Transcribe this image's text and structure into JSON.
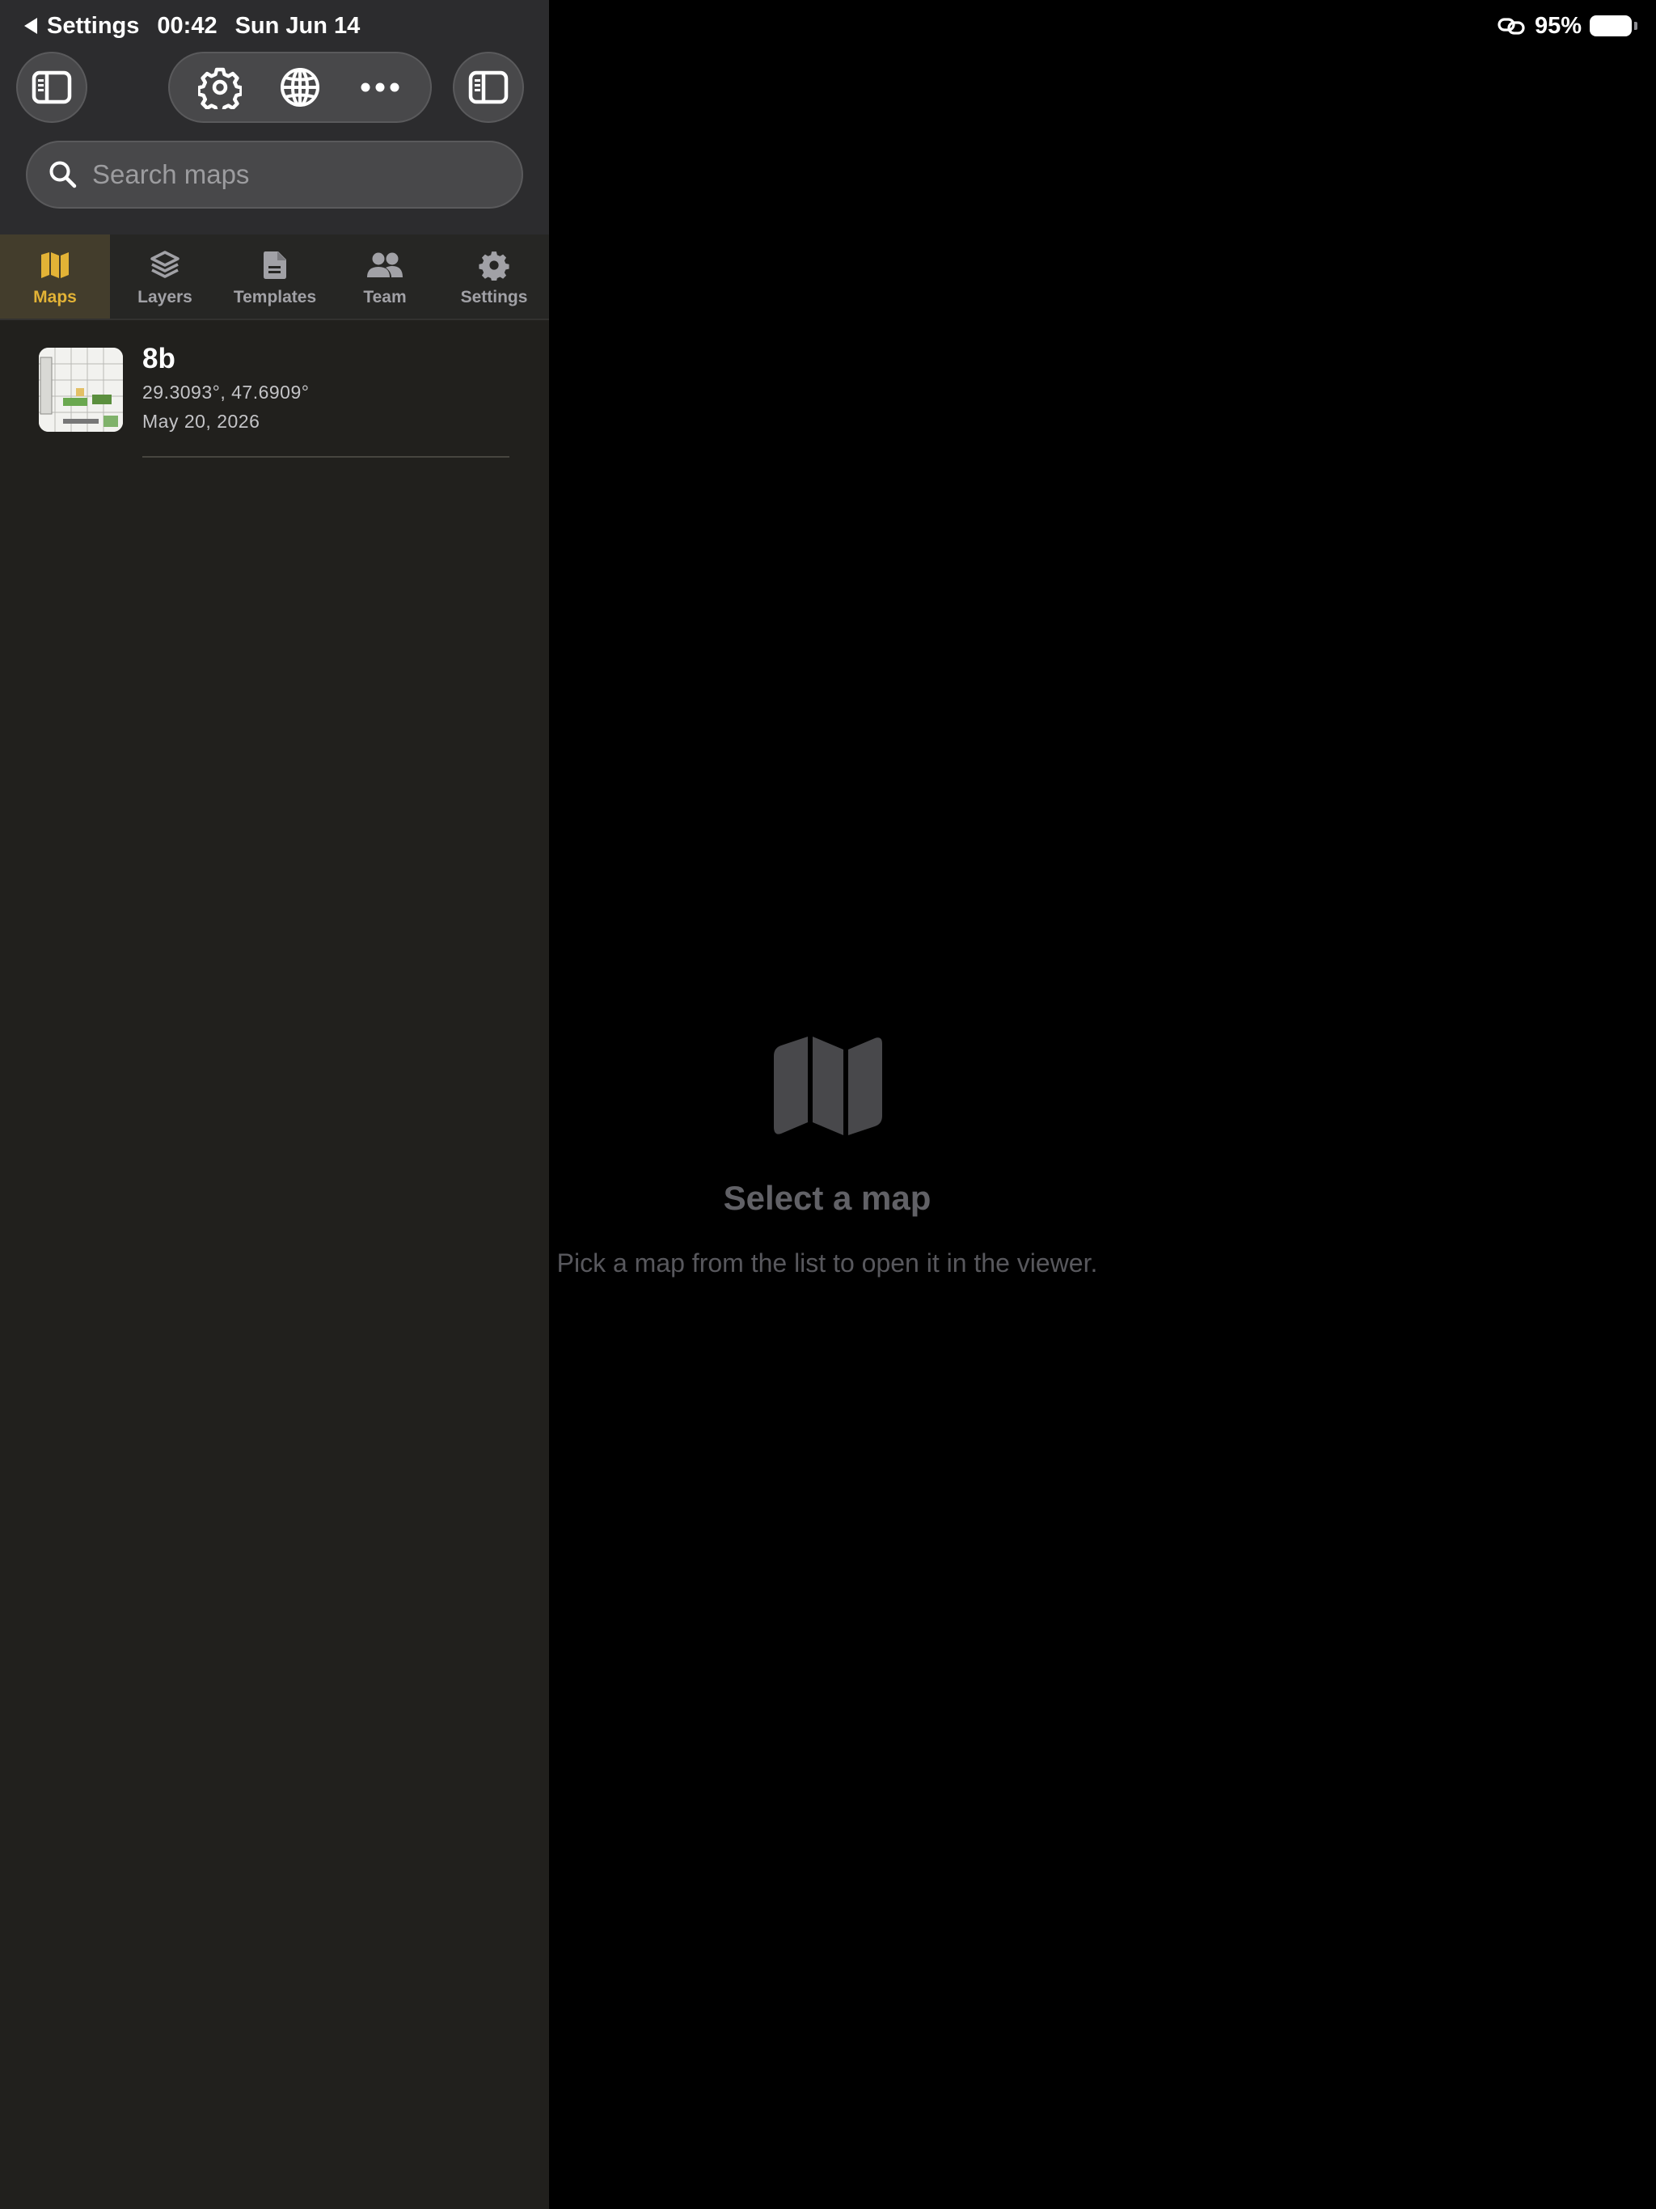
{
  "status_bar": {
    "back_label": "Settings",
    "time": "00:42",
    "date": "Sun Jun 14",
    "battery": "95%"
  },
  "search": {
    "placeholder": "Search maps"
  },
  "tabs": [
    {
      "label": "Maps",
      "icon": "map-icon",
      "active": true
    },
    {
      "label": "Layers",
      "icon": "layers-icon",
      "active": false
    },
    {
      "label": "Templates",
      "icon": "document-icon",
      "active": false
    },
    {
      "label": "Team",
      "icon": "people-icon",
      "active": false
    },
    {
      "label": "Settings",
      "icon": "gear-icon",
      "active": false
    }
  ],
  "maps": [
    {
      "name": "8b",
      "coordinates": "29.3093°, 47.6909°",
      "date": "May 20, 2026"
    }
  ],
  "empty_state": {
    "title": "Select a map",
    "subtitle": "Pick a map from the list to open it in the viewer."
  },
  "colors": {
    "accent": "#e3b336",
    "sidebar_bg": "#21201d",
    "header_bg": "#2c2c2e",
    "viewer_bg": "#000000"
  }
}
